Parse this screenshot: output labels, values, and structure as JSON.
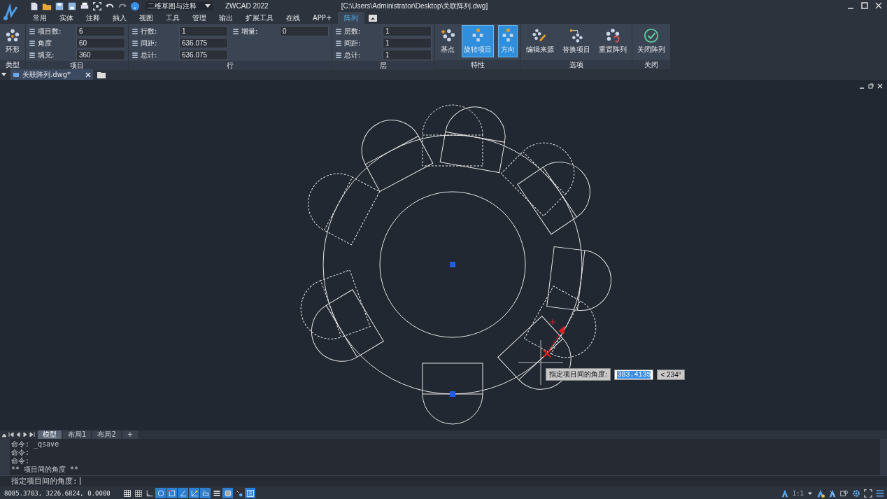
{
  "title_bar": {
    "workspace": "二维草图与注释",
    "app_name": "ZWCAD 2022",
    "file_path": "[C:\\Users\\Administrator\\Desktop\\关联阵列.dwg]"
  },
  "menu_tabs": [
    {
      "label": "常用",
      "selected": false
    },
    {
      "label": "实体",
      "selected": false
    },
    {
      "label": "注释",
      "selected": false
    },
    {
      "label": "插入",
      "selected": false
    },
    {
      "label": "视图",
      "selected": false
    },
    {
      "label": "工具",
      "selected": false
    },
    {
      "label": "管理",
      "selected": false
    },
    {
      "label": "输出",
      "selected": false
    },
    {
      "label": "扩展工具",
      "selected": false
    },
    {
      "label": "在线",
      "selected": false
    },
    {
      "label": "APP+",
      "selected": false
    },
    {
      "label": "阵列",
      "selected": true
    }
  ],
  "ribbon": {
    "panels": [
      {
        "title": "类型",
        "kind": "buttons",
        "buttons": [
          {
            "label": "环形",
            "selected": false
          }
        ]
      },
      {
        "title": "项目",
        "kind": "fields",
        "columns": [
          [
            {
              "label": "项目数:",
              "value": "6"
            },
            {
              "label": "角度",
              "value": "60"
            },
            {
              "label": "填充:",
              "value": "360"
            }
          ]
        ]
      },
      {
        "title": "行",
        "kind": "fields",
        "columns": [
          [
            {
              "label": "行数:",
              "value": "1"
            },
            {
              "label": "间距:",
              "value": "636.075"
            },
            {
              "label": "总计:",
              "value": "636.075"
            }
          ],
          [
            {
              "label": "增量:",
              "value": "0"
            }
          ]
        ]
      },
      {
        "title": "层",
        "kind": "fields",
        "columns": [
          [
            {
              "label": "层数:",
              "value": "1"
            },
            {
              "label": "间距:",
              "value": "1"
            },
            {
              "label": "总计:",
              "value": "1"
            }
          ]
        ]
      },
      {
        "title": "特性",
        "kind": "buttons",
        "buttons": [
          {
            "label": "基点",
            "selected": false
          },
          {
            "label": "旋转项目",
            "selected": true
          },
          {
            "label": "方向",
            "selected": true
          }
        ]
      },
      {
        "title": "选项",
        "kind": "buttons",
        "buttons": [
          {
            "label": "编辑来源",
            "selected": false
          },
          {
            "label": "替换项目",
            "selected": false
          },
          {
            "label": "重置阵列",
            "selected": false
          }
        ]
      },
      {
        "title": "关闭",
        "kind": "buttons",
        "buttons": [
          {
            "label": "关闭阵列",
            "selected": false
          }
        ]
      }
    ]
  },
  "doc_tabs": [
    {
      "label": "关联阵列.dwg*",
      "selected": true
    }
  ],
  "canvas": {
    "tooltip": {
      "prompt": "指定项目间的角度:",
      "value": "383.4135",
      "angle": "< 234°"
    }
  },
  "layout_tabs": [
    {
      "label": "模型",
      "selected": true
    },
    {
      "label": "布局1",
      "selected": false
    },
    {
      "label": "布局2",
      "selected": false
    },
    {
      "label": "+",
      "selected": false
    }
  ],
  "command_history": [
    "命令: _qsave",
    "命令:",
    "命令:",
    "** 项目间的角度 **"
  ],
  "command_line": {
    "prompt": "指定项目间的角度:"
  },
  "status_bar": {
    "coordinates": "8085.3703, 3226.6824, 0.0000",
    "toggles": [
      {
        "on": false
      },
      {
        "on": false
      },
      {
        "on": false
      },
      {
        "on": true
      },
      {
        "on": true
      },
      {
        "on": true
      },
      {
        "on": true
      },
      {
        "on": true
      },
      {
        "on": false
      },
      {
        "on": true
      },
      {
        "on": false
      },
      {
        "on": true
      }
    ],
    "scale": "1:1"
  }
}
